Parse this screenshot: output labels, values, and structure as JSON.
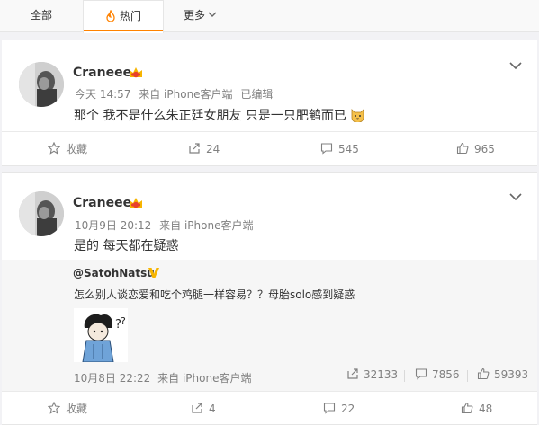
{
  "tabs": {
    "all": "全部",
    "hot": "热门",
    "more": "更多"
  },
  "colors": {
    "accent": "#ff8200",
    "vip": "#f7b500"
  },
  "posts": [
    {
      "username": "Craneee",
      "time": "今天 14:57",
      "source": "来自 iPhone客户端",
      "edited": "已编辑",
      "text": "那个 我不是什么朱正廷女朋友 只是一只肥鹌而已",
      "actions": {
        "favorite": "收藏",
        "repost": "24",
        "comment": "545",
        "like": "965"
      }
    },
    {
      "username": "Craneee",
      "time": "10月9日 20:12",
      "source": "来自 iPhone客户端",
      "text": "是的 每天都在疑惑",
      "repost": {
        "user": "@SatohNatsu",
        "text": "怎么别人谈恋爱和吃个鸡腿一样容易？？母胎solo感到疑惑",
        "time": "10月8日 22:22",
        "source": "来自 iPhone客户端",
        "reposts": "32133",
        "comments": "7856",
        "likes": "59393"
      },
      "actions": {
        "favorite": "收藏",
        "repost": "4",
        "comment": "22",
        "like": "48"
      }
    }
  ]
}
